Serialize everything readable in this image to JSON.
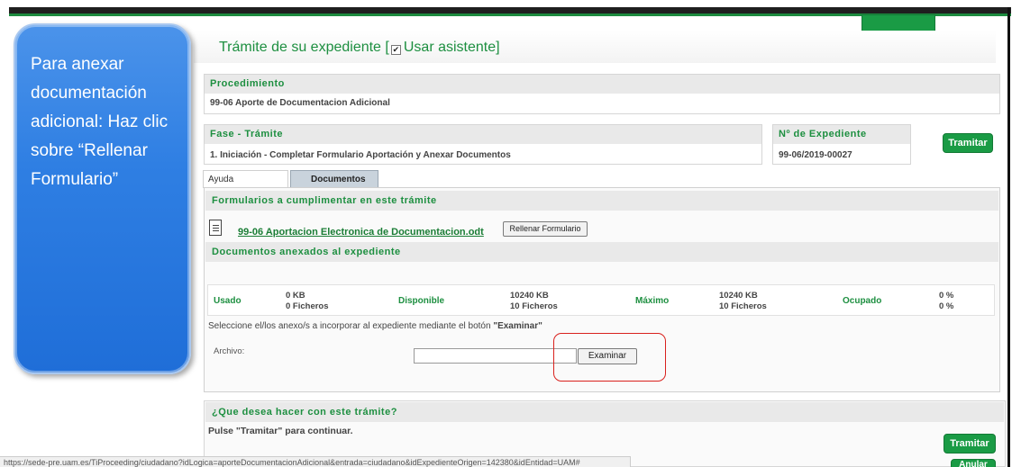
{
  "page_title": {
    "text": "Trámite de su expediente",
    "bracket_open": "[",
    "checkbox_mark": "✔",
    "assistant_label": "Usar asistente]"
  },
  "procedimiento": {
    "heading": "Procedimiento",
    "value": "99-06 Aporte de Documentacion Adicional"
  },
  "fase": {
    "heading": "Fase - Trámite",
    "value": "1. Iniciación - Completar Formulario Aportación y Anexar Documentos"
  },
  "expediente": {
    "heading": "Nº de Expediente",
    "value": "99-06/2019-00027"
  },
  "buttons": {
    "tramitar": "Tramitar",
    "tramitar_bottom": "Tramitar",
    "anular": "Anular",
    "rellenar": "Rellenar Formulario",
    "examinar": "Examinar"
  },
  "tabs": [
    {
      "label": "Ayuda"
    },
    {
      "label": "Documentos"
    }
  ],
  "formularios": {
    "heading": "Formularios a cumplimentar en este trámite",
    "link": "99-06 Aportacion Electronica de Documentacion.odt"
  },
  "documentos": {
    "heading": "Documentos anexados al expediente",
    "usado_label": "Usado",
    "usado_kb": "0 KB",
    "usado_files": "0 Ficheros",
    "disponible_label": "Disponible",
    "disponible_kb": "10240 KB",
    "disponible_files": "10 Ficheros",
    "maximo_label": "Máximo",
    "maximo_kb": "10240 KB",
    "maximo_files": "10 Ficheros",
    "ocupado_label": "Ocupado",
    "ocupado_1": "0 %",
    "ocupado_2": "0 %"
  },
  "instructions": {
    "select_text_pre": "Seleccione el/los anexo/s a incorporar al expediente mediante el botón ",
    "select_text_bold": "\"Examinar\"",
    "archivo_label": "Archivo:"
  },
  "next_step": {
    "heading": "¿Que desea hacer con este trámite?",
    "pulse_text": "Pulse \"Tramitar\" para continuar."
  },
  "status_bar": {
    "url": "https://sede-pre.uam.es/TiProceeding/ciudadano?idLogica=aporteDocumentacionAdicional&entrada=ciudadano&idExpedienteOrigen=142380&idEntidad=UAM#"
  },
  "callout": {
    "text": "Para anexar documentación adicional: Haz clic sobre “Rellenar Formulario”"
  }
}
